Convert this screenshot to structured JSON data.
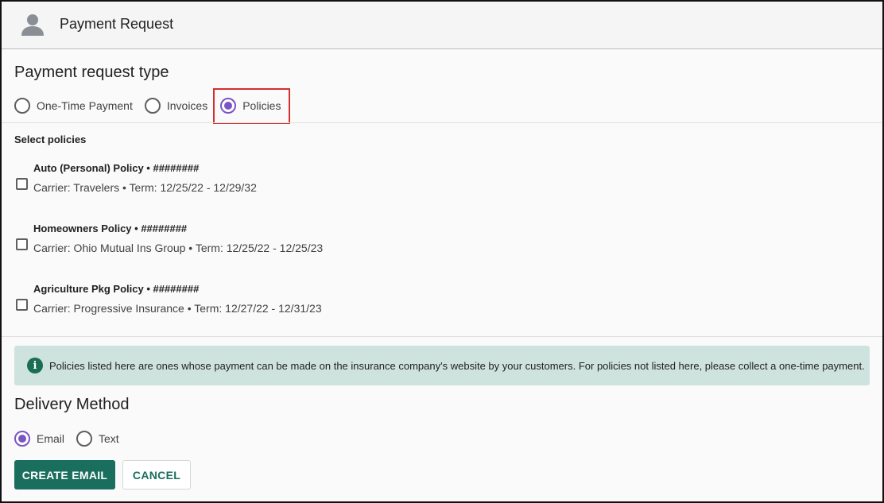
{
  "header": {
    "title": "Payment Request",
    "icon": "person-icon"
  },
  "request_type": {
    "title": "Payment request type",
    "options": [
      {
        "label": "One-Time Payment",
        "selected": false
      },
      {
        "label": "Invoices",
        "selected": false
      },
      {
        "label": "Policies",
        "selected": true
      }
    ]
  },
  "policies": {
    "heading": "Select policies",
    "items": [
      {
        "title": "Auto (Personal) Policy • ########",
        "detail": "Carrier: Travelers • Term: 12/25/22 - 12/29/32",
        "checked": false
      },
      {
        "title": "Homeowners Policy • ########",
        "detail": "Carrier: Ohio Mutual Ins Group • Term: 12/25/22 - 12/25/23",
        "checked": false
      },
      {
        "title": "Agriculture Pkg Policy • ########",
        "detail": "Carrier: Progressive Insurance • Term: 12/27/22 - 12/31/23",
        "checked": false
      }
    ]
  },
  "info": {
    "icon": "info-icon",
    "text": "Policies listed here are ones whose payment can be made on the insurance company's website by your customers. For policies not listed here, please collect a one-time payment."
  },
  "delivery": {
    "title": "Delivery Method",
    "options": [
      {
        "label": "Email",
        "selected": true
      },
      {
        "label": "Text",
        "selected": false
      }
    ]
  },
  "actions": {
    "primary_label": "CREATE EMAIL",
    "secondary_label": "CANCEL"
  },
  "colors": {
    "accent_purple": "#7b54c4",
    "brand_green": "#1a6e5e",
    "banner_bg": "#cfe3de",
    "highlight_red": "#d32f2f"
  }
}
